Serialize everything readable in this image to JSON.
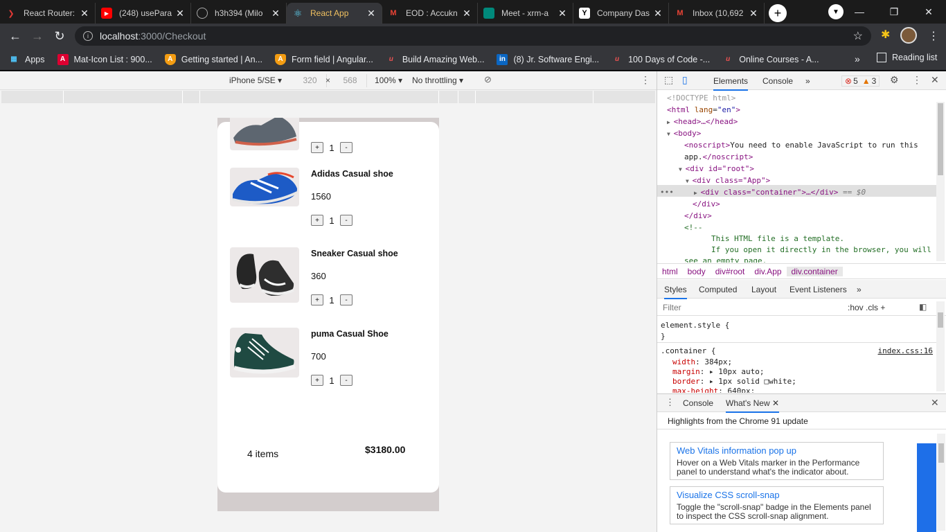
{
  "browser": {
    "tabs": [
      {
        "title": "React Router:",
        "icon": "react-router-icon",
        "active": false
      },
      {
        "title": "(248) usePara",
        "icon": "youtube-icon",
        "active": false
      },
      {
        "title": "h3h394 (Milo",
        "icon": "github-icon",
        "active": false
      },
      {
        "title": "React App",
        "icon": "react-icon",
        "active": true
      },
      {
        "title": "EOD : Accukn",
        "icon": "gmail-icon",
        "active": false
      },
      {
        "title": "Meet - xrm-a",
        "icon": "meet-icon",
        "active": false
      },
      {
        "title": "Company Das",
        "icon": "ycombinator-icon",
        "active": false
      },
      {
        "title": "Inbox (10,692",
        "icon": "gmail-icon",
        "active": false
      }
    ],
    "new_tab_label": "+",
    "url_host": "localhost",
    "url_path": ":3000/Checkout",
    "bookmarks": [
      {
        "label": "Apps",
        "icon": "apps-grid-icon"
      },
      {
        "label": "Mat-Icon List : 900...",
        "icon": "angular-icon"
      },
      {
        "label": "Getting started | An...",
        "icon": "angular-shield-icon"
      },
      {
        "label": "Form field | Angular...",
        "icon": "angular-shield-icon"
      },
      {
        "label": "Build Amazing Web...",
        "icon": "udemy-icon"
      },
      {
        "label": "(8) Jr. Software Engi...",
        "icon": "linkedin-icon"
      },
      {
        "label": "100 Days of Code -...",
        "icon": "udemy-icon"
      },
      {
        "label": "Online Courses - A...",
        "icon": "udemy-icon"
      }
    ],
    "bookmarks_more": "»",
    "reading_list": "Reading list"
  },
  "device_toolbar": {
    "device": "iPhone 5/SE",
    "width": "320",
    "height": "568",
    "times": "×",
    "zoom": "100%",
    "throttle": "No throttling"
  },
  "cart": {
    "items": [
      {
        "name": "",
        "price": "",
        "qty": "1",
        "plus": "+",
        "minus": "-"
      },
      {
        "name": "Adidas Casual shoe",
        "price": "1560",
        "qty": "1",
        "plus": "+",
        "minus": "-"
      },
      {
        "name": "Sneaker Casual shoe",
        "price": "360",
        "qty": "1",
        "plus": "+",
        "minus": "-"
      },
      {
        "name": "puma Casual Shoe",
        "price": "700",
        "qty": "1",
        "plus": "+",
        "minus": "-"
      }
    ],
    "count_label": "4 items",
    "total": "$3180.00"
  },
  "devtools": {
    "tabs": [
      "Elements",
      "Console"
    ],
    "more": "»",
    "errors": "5",
    "warnings": "3",
    "breadcrumbs": [
      "html",
      "body",
      "div#root",
      "div.App",
      "div.container"
    ],
    "style_tabs": [
      "Styles",
      "Computed",
      "Layout",
      "Event Listeners"
    ],
    "filter_placeholder": "Filter",
    "filter_opts": ":hov  .cls  +",
    "dom": {
      "doctype": "<!DOCTYPE html>",
      "html_open": "<html",
      "html_lang_attr": "lang",
      "html_lang_val": "\"en\"",
      "head": "<head>…</head>",
      "body": "<body>",
      "noscript_open": "<noscript>",
      "noscript_text": "You need to enable JavaScript to run this",
      "noscript_text2": "app.",
      "noscript_close": "</noscript>",
      "root_div": "<div id=\"root\">",
      "app_div": "<div class=\"App\">",
      "container_div": "<div class=\"container\">…</div>",
      "selected_marker": "== $0",
      "div_close1": "</div>",
      "div_close2": "</div>",
      "comment_open": "<!--",
      "comment1": "This HTML file is a template.",
      "comment2": "If you open it directly in the browser, you will",
      "comment3": "see an empty page."
    },
    "styles": {
      "element_style": "element.style {",
      "close": "}",
      "selector": ".container {",
      "source": "index.css:16",
      "rules": [
        {
          "prop": "width",
          "val": "384px;"
        },
        {
          "prop": "margin",
          "val": "▸ 10px auto;"
        },
        {
          "prop": "border",
          "val": "▸ 1px solid □white;"
        },
        {
          "prop": "max-height",
          "val": "640px;"
        }
      ]
    },
    "drawer_tabs": [
      "Console",
      "What's New"
    ],
    "whats_new_heading": "Highlights from the Chrome 91 update",
    "whats_new_cards": [
      {
        "title": "Web Vitals information pop up",
        "desc": "Hover on a Web Vitals marker in the Performance panel to understand what's the indicator about."
      },
      {
        "title": "Visualize CSS scroll-snap",
        "desc": "Toggle the \"scroll-snap\" badge in the Elements panel to inspect the CSS scroll-snap alignment."
      }
    ]
  }
}
